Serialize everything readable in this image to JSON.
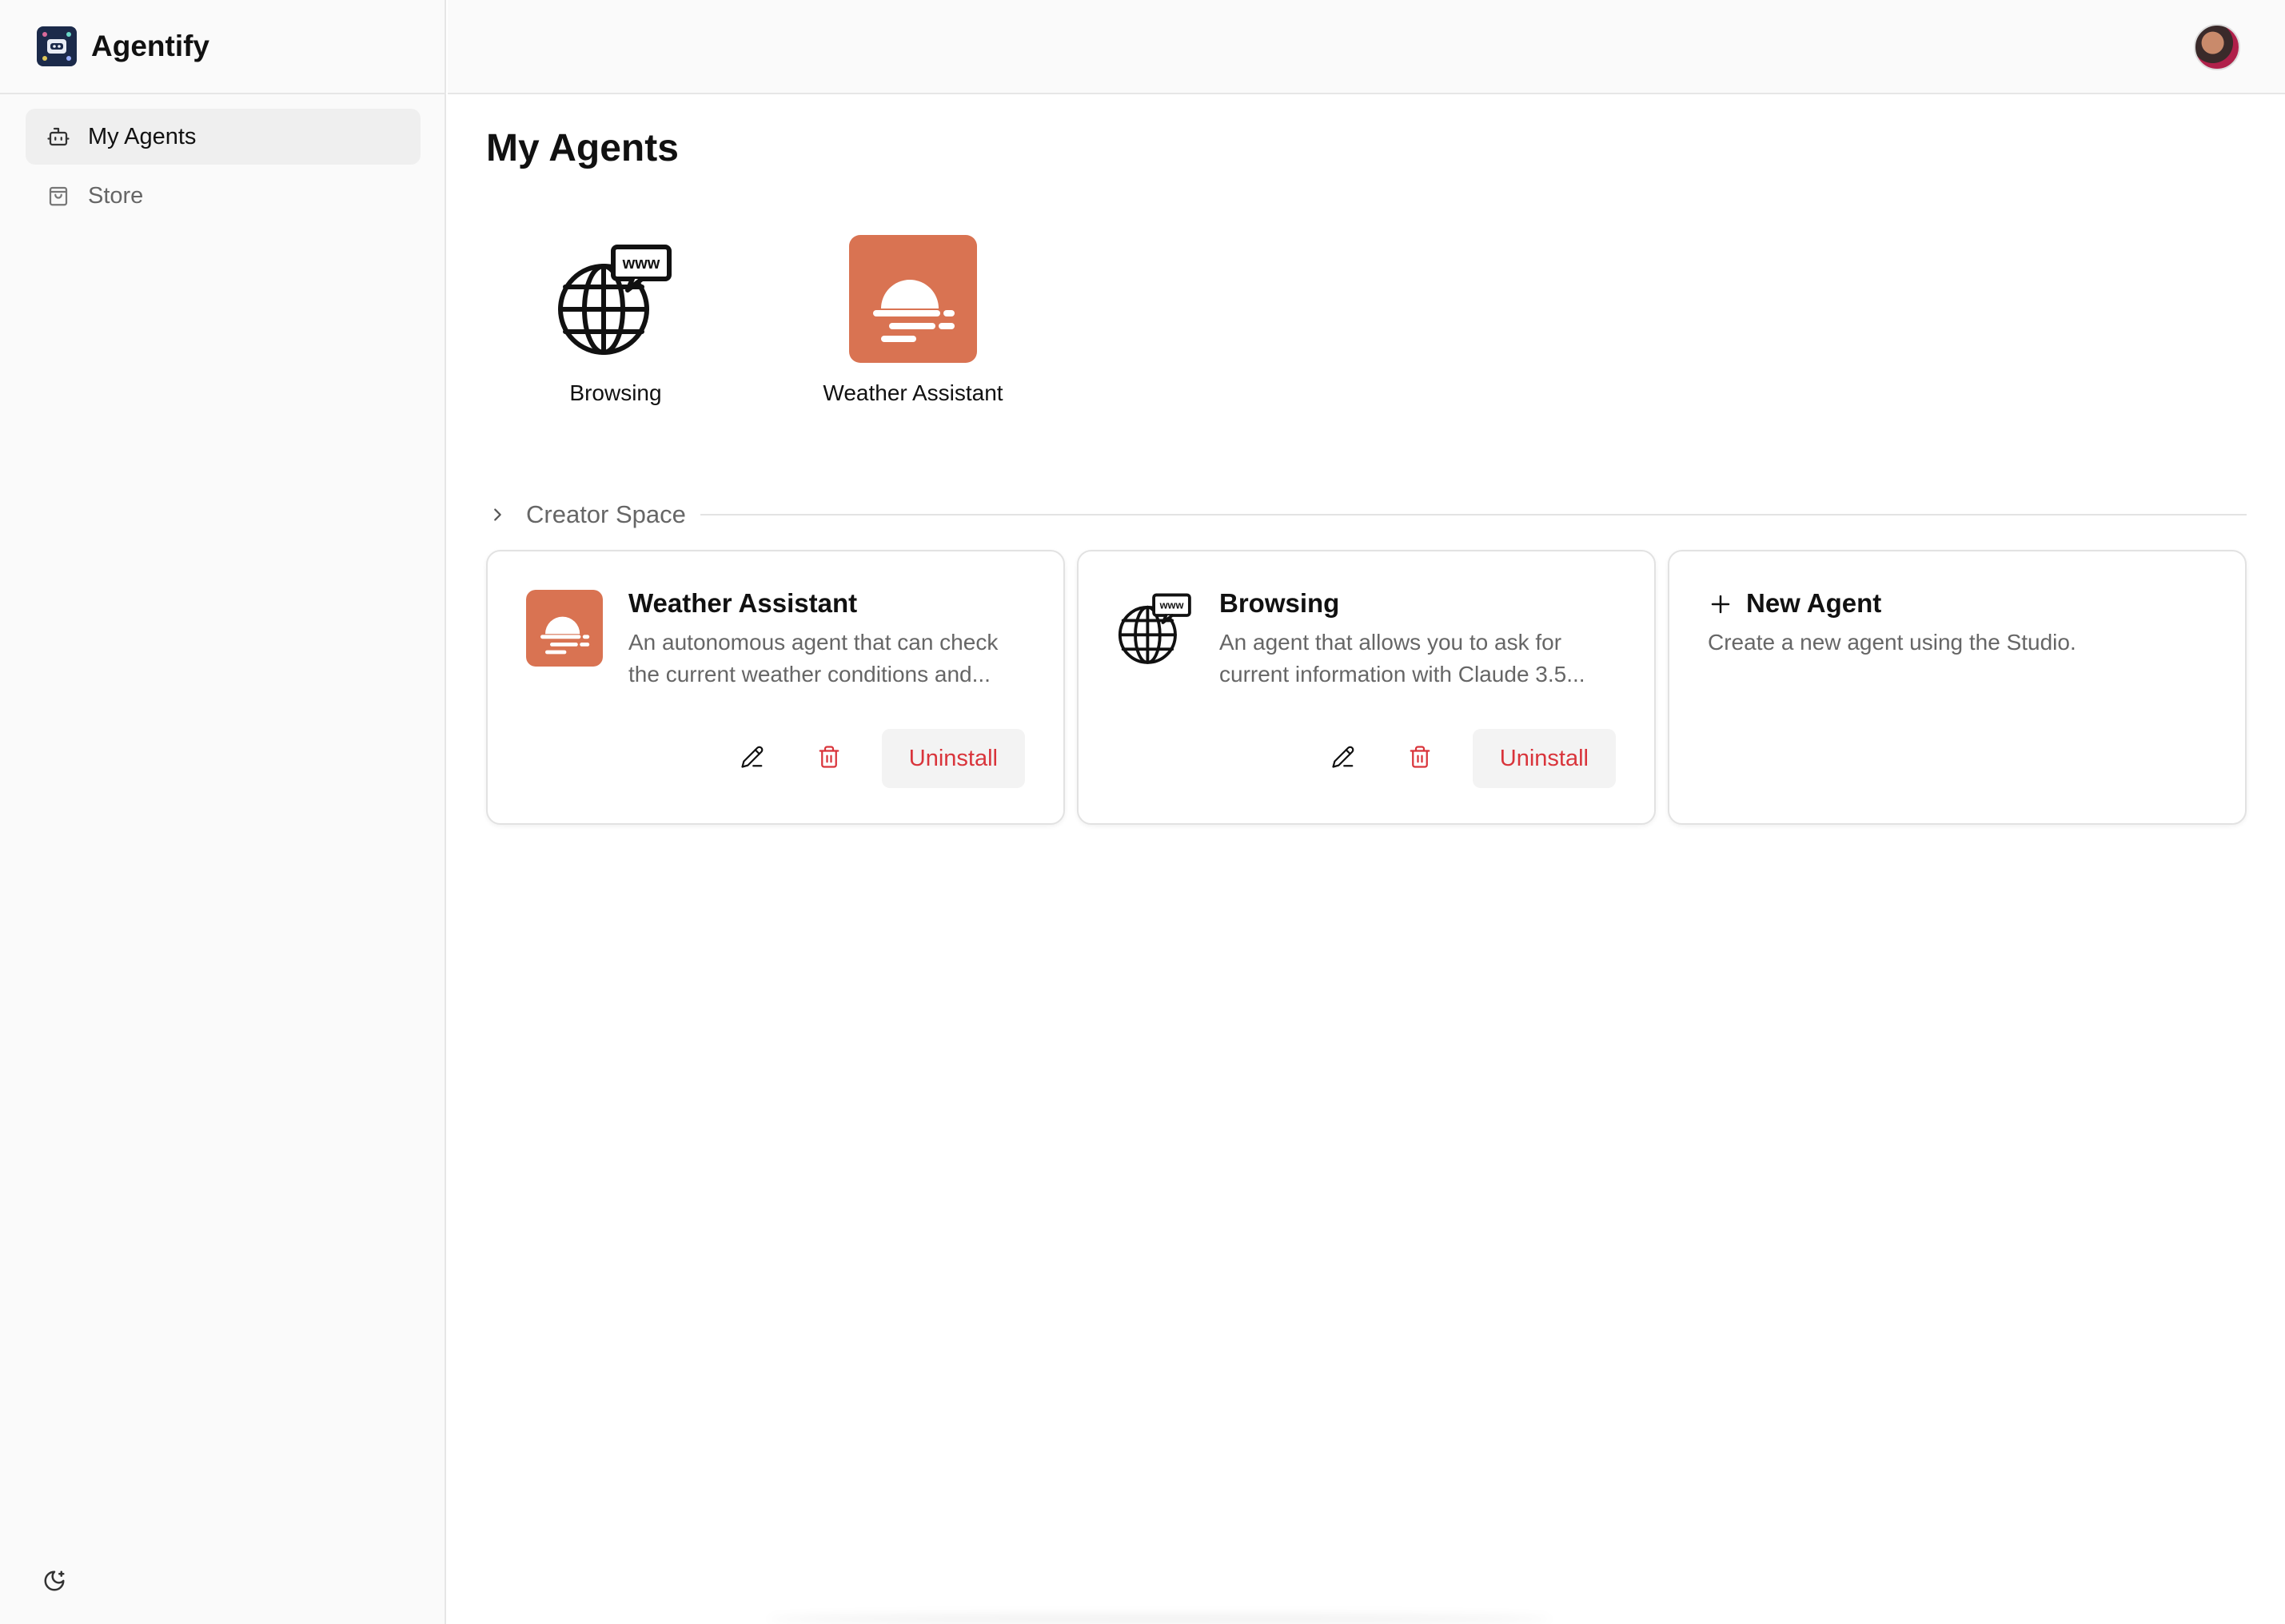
{
  "app": {
    "title": "Agentify"
  },
  "sidebar": {
    "items": [
      {
        "label": "My Agents",
        "icon": "bot-icon",
        "active": true
      },
      {
        "label": "Store",
        "icon": "shopping-bag-icon",
        "active": false
      }
    ],
    "theme_toggle_icon": "moon-icon"
  },
  "header": {
    "avatar_icon": "user-avatar"
  },
  "main": {
    "title": "My Agents",
    "installed": [
      {
        "label": "Browsing",
        "icon": "globe-www-icon"
      },
      {
        "label": "Weather Assistant",
        "icon": "weather-icon"
      }
    ],
    "creator_space": {
      "title": "Creator Space",
      "cards": [
        {
          "title": "Weather Assistant",
          "description": "An autonomous agent that can check the current weather conditions and...",
          "icon": "weather-icon",
          "uninstall_label": "Uninstall"
        },
        {
          "title": "Browsing",
          "description": "An agent that allows you to ask for current information with Claude 3.5...",
          "icon": "globe-www-icon",
          "uninstall_label": "Uninstall"
        }
      ],
      "new_agent": {
        "title": "New Agent",
        "description": "Create a new agent using the Studio."
      }
    }
  },
  "colors": {
    "accent_orange": "#d97352",
    "danger_red": "#d9343b",
    "sidebar_bg": "#fafafa",
    "border": "#e6e6e6"
  }
}
